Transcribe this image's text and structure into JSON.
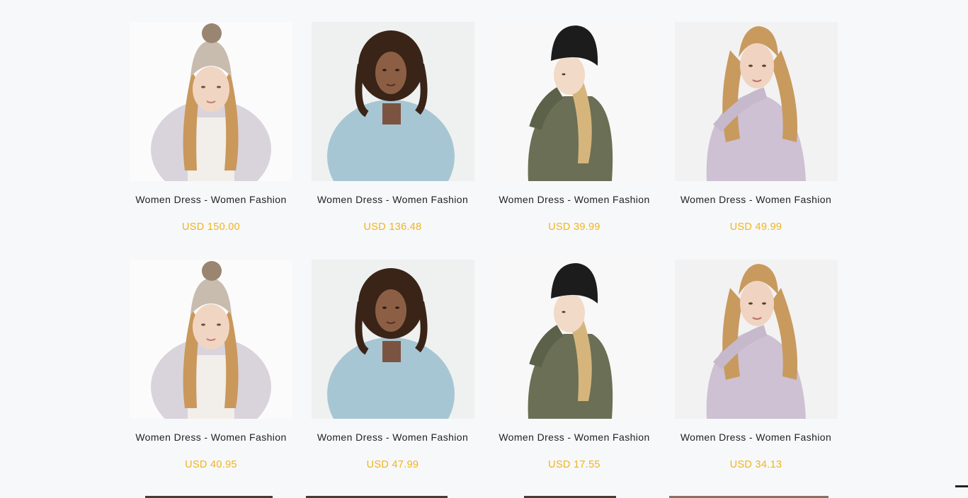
{
  "products": [
    {
      "title": "Women Dress - Women Fashion",
      "price": "USD 150.00",
      "image": "woman-pom-hat-lilac-jacket"
    },
    {
      "title": "Women Dress - Women Fashion",
      "price": "USD 136.48",
      "image": "woman-curly-hair-light-blue-sweater"
    },
    {
      "title": "Women Dress - Women Fashion",
      "price": "USD 39.99",
      "image": "woman-black-beanie-olive-sweater"
    },
    {
      "title": "Women Dress - Women Fashion",
      "price": "USD 49.99",
      "image": "woman-blonde-lilac-sweater"
    },
    {
      "title": "Women Dress - Women Fashion",
      "price": "USD 40.95",
      "image": "woman-pom-hat-lilac-jacket"
    },
    {
      "title": "Women Dress - Women Fashion",
      "price": "USD 47.99",
      "image": "woman-curly-hair-light-blue-sweater"
    },
    {
      "title": "Women Dress - Women Fashion",
      "price": "USD 17.55",
      "image": "woman-black-beanie-olive-sweater"
    },
    {
      "title": "Women Dress - Women Fashion",
      "price": "USD 34.13",
      "image": "woman-blonde-lilac-sweater"
    }
  ],
  "colors": {
    "background": "#f7f8fa",
    "title_text": "#222222",
    "price_accent": "#f0b41f"
  }
}
